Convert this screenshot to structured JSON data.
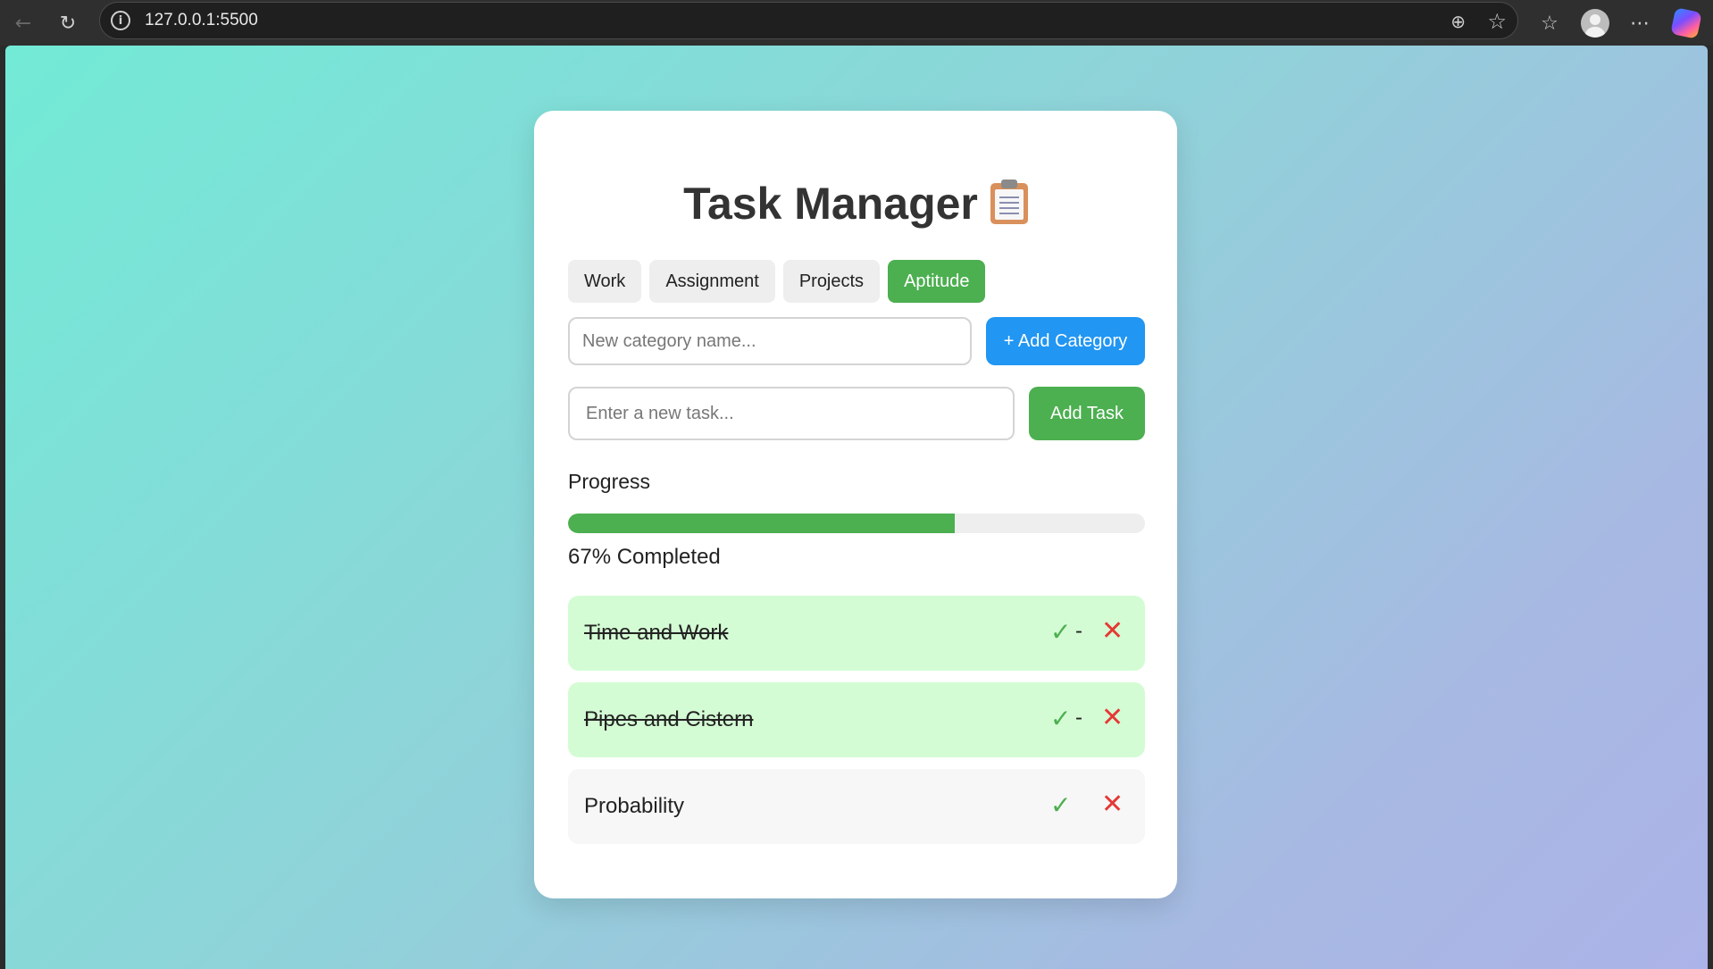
{
  "browser": {
    "url": "127.0.0.1:5500"
  },
  "app": {
    "title": "Task Manager",
    "title_icon": "clipboard-icon"
  },
  "categories": [
    {
      "label": "Work",
      "active": false
    },
    {
      "label": "Assignment",
      "active": false
    },
    {
      "label": "Projects",
      "active": false
    },
    {
      "label": "Aptitude",
      "active": true
    }
  ],
  "category_form": {
    "placeholder": "New category name...",
    "value": "",
    "button_label": "+ Add Category"
  },
  "task_form": {
    "placeholder": "Enter a new task...",
    "value": "",
    "button_label": "Add Task"
  },
  "progress": {
    "label": "Progress",
    "percent": 67,
    "text": "67% Completed"
  },
  "tasks": [
    {
      "name": "Time and Work",
      "completed": true,
      "check": "✓",
      "dash": "-",
      "delete": "✕"
    },
    {
      "name": "Pipes and Cistern",
      "completed": true,
      "check": "✓",
      "dash": "-",
      "delete": "✕"
    },
    {
      "name": "Probability",
      "completed": false,
      "check": "✓",
      "dash": "",
      "delete": "✕"
    }
  ],
  "colors": {
    "accent_green": "#4caf50",
    "accent_blue": "#2196f3",
    "delete_red": "#e53935",
    "completed_row_bg": "#d4fcd4"
  }
}
